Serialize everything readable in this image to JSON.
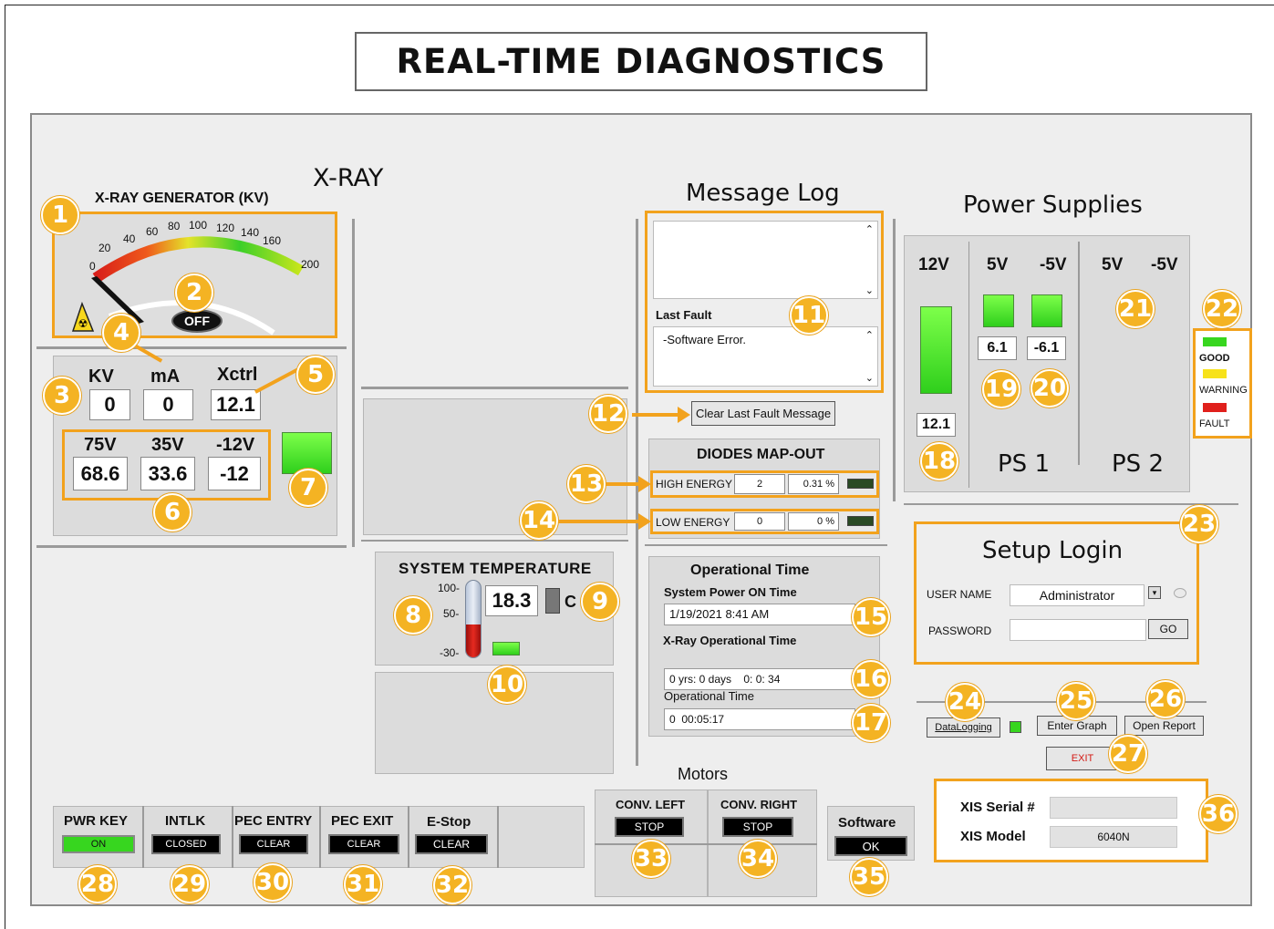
{
  "title": "REAL-TIME DIAGNOSTICS",
  "xray": {
    "section_title": "X-RAY",
    "gauge_title": "X-RAY GENERATOR (KV)",
    "gauge_ticks": [
      "0",
      "20",
      "40",
      "60",
      "80",
      "100",
      "120",
      "140",
      "160",
      "200"
    ],
    "gauge_state": "OFF",
    "kv_label": "KV",
    "ma_label": "mA",
    "xctrl_label": "Xctrl",
    "kv_value": "0",
    "ma_value": "0",
    "xctrl_value": "12.1",
    "v75_label": "75V",
    "v35_label": "35V",
    "vm12_label": "-12V",
    "v75_value": "68.6",
    "v35_value": "33.6",
    "vm12_value": "-12"
  },
  "temperature": {
    "title": "SYSTEM TEMPERATURE",
    "scale": [
      "100-",
      "50-",
      "-30-"
    ],
    "value": "18.3",
    "unit": "C"
  },
  "message_log": {
    "title": "Message Log",
    "last_fault_label": "Last Fault",
    "last_fault_text": "-Software Error.",
    "clear_button": "Clear Last Fault Message"
  },
  "diodes": {
    "title": "DIODES MAP-OUT",
    "high_label": "HIGH ENERGY",
    "high_count": "2",
    "high_pct": "0.31 %",
    "low_label": "LOW ENERGY",
    "low_count": "0",
    "low_pct": "0 %"
  },
  "operational": {
    "title": "Operational Time",
    "power_on_label": "System Power ON Time",
    "power_on_value": "1/19/2021 8:41 AM",
    "xray_label": "X-Ray Operational Time",
    "xray_value": "0 yrs: 0 days    0: 0: 34",
    "op_label": "Operational Time",
    "op_value": "0  00:05:17"
  },
  "power": {
    "title": "Power Supplies",
    "v12": "12V",
    "v5": "5V",
    "vm5": "-5V",
    "v5b": "5V",
    "vm5b": "-5V",
    "v12_value": "12.1",
    "v5_value": "6.1",
    "vm5_value": "-6.1",
    "ps1": "PS 1",
    "ps2": "PS 2"
  },
  "legend": {
    "good": "GOOD",
    "warning": "WARNING",
    "fault": "FAULT"
  },
  "login": {
    "title": "Setup Login",
    "user_label": "USER NAME",
    "user_value": "Administrator",
    "password_label": "PASSWORD",
    "go_button": "GO"
  },
  "buttons": {
    "datalogging": "DataLogging",
    "enter_graph": "Enter Graph",
    "open_report": "Open Report",
    "exit": "EXIT"
  },
  "xis": {
    "serial_label": "XIS Serial #",
    "model_label": "XIS Model",
    "model_value": "6040N",
    "serial_value": ""
  },
  "status": {
    "pwr_key": "PWR KEY",
    "pwr_key_val": "ON",
    "intlk": "INTLK",
    "intlk_val": "CLOSED",
    "pec_entry": "PEC ENTRY",
    "pec_entry_val": "CLEAR",
    "pec_exit": "PEC EXIT",
    "pec_exit_val": "CLEAR",
    "estop": "E-Stop",
    "estop_val": "CLEAR"
  },
  "motors": {
    "title": "Motors",
    "conv_left": "CONV. LEFT",
    "conv_left_val": "STOP",
    "conv_right": "CONV. RIGHT",
    "conv_right_val": "STOP"
  },
  "software": {
    "label": "Software",
    "value": "OK"
  },
  "callouts": [
    "1",
    "2",
    "3",
    "4",
    "5",
    "6",
    "7",
    "8",
    "9",
    "10",
    "11",
    "12",
    "13",
    "14",
    "15",
    "16",
    "17",
    "18",
    "19",
    "20",
    "21",
    "22",
    "23",
    "24",
    "25",
    "26",
    "27",
    "28",
    "29",
    "30",
    "31",
    "32",
    "33",
    "34",
    "35",
    "36"
  ],
  "colors": {
    "accent": "#f4b323",
    "good": "#37d61f",
    "warning": "#f7e21a",
    "fault": "#e0201c"
  }
}
